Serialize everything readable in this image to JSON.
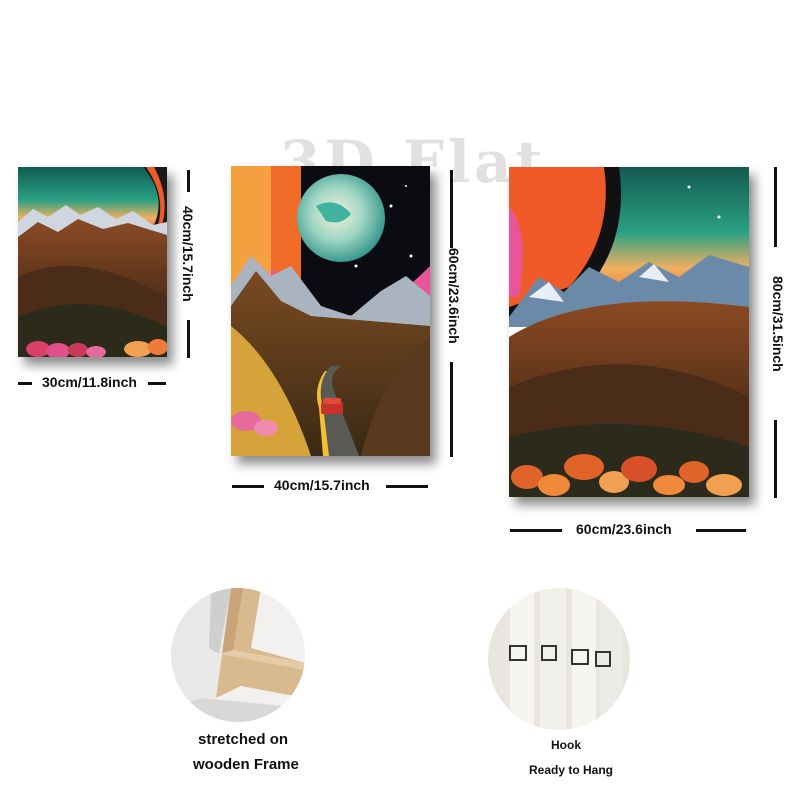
{
  "watermark": "3D Flat",
  "panels": {
    "small": {
      "width_label": "30cm/11.8inch",
      "height_label": "40cm/15.7inch"
    },
    "medium": {
      "width_label": "40cm/15.7inch",
      "height_label": "60cm/23.6inch"
    },
    "large": {
      "width_label": "60cm/23.6inch",
      "height_label": "80cm/31.5inch"
    }
  },
  "details": {
    "frame": {
      "caption_line1": "stretched on",
      "caption_line2": "wooden Frame"
    },
    "hook": {
      "caption_line1": "Hook",
      "caption_line2": "Ready to Hang"
    }
  },
  "colors": {
    "sky_teal": "#1f8f7a",
    "horizon_orange": "#f0a040",
    "ring_orange": "#f05a28",
    "ring_pink": "#e8559a",
    "hills_brown": "#6b3a20",
    "road_gray": "#5a5a55",
    "shrubs": "#e0642a"
  }
}
